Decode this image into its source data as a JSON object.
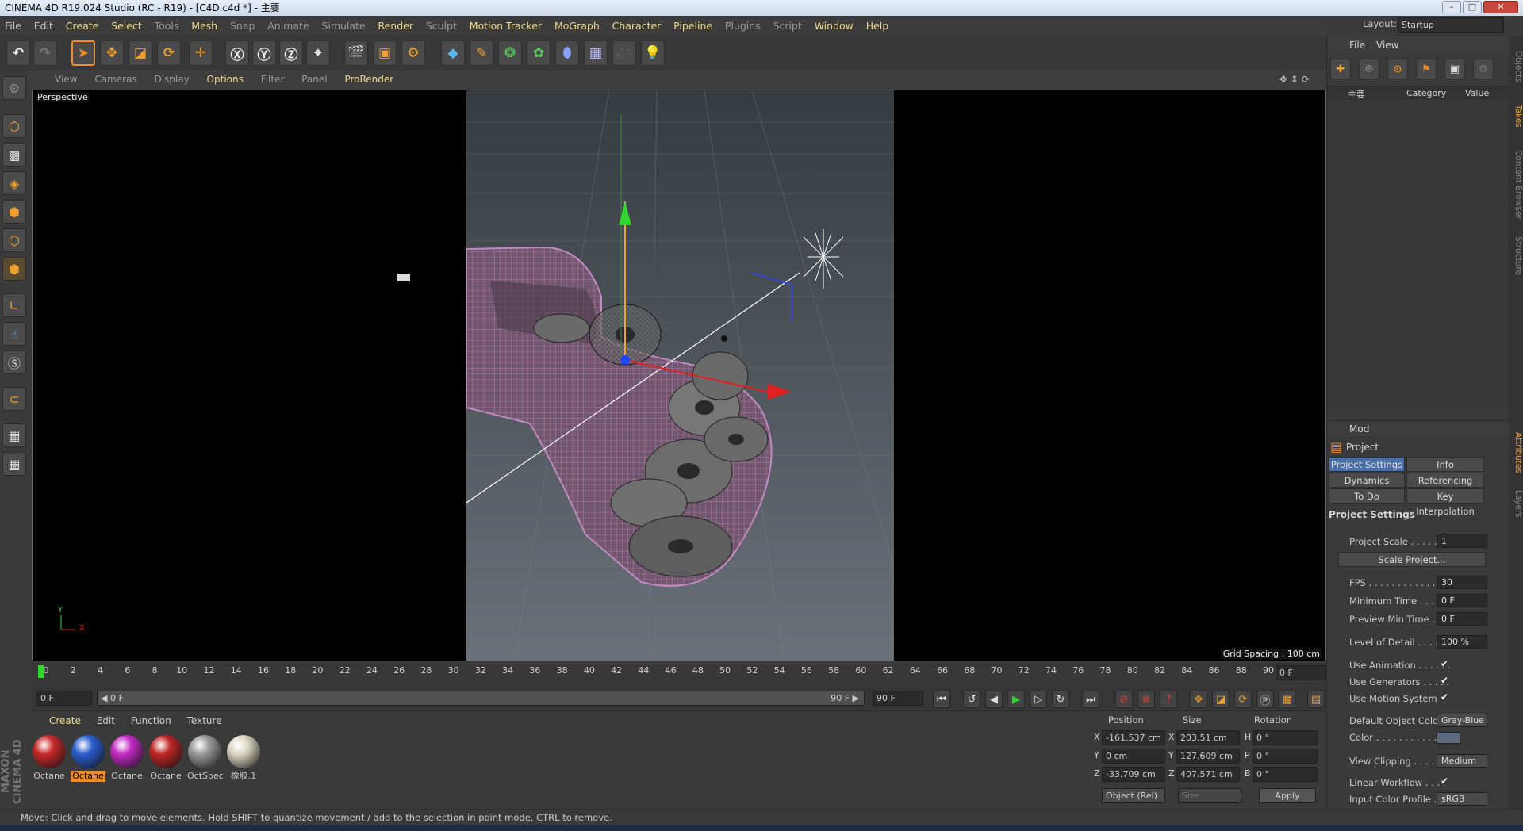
{
  "window": {
    "title": "CINEMA 4D R19.024 Studio (RC - R19) - [C4D.c4d *] - 主要",
    "layout_label": "Layout:",
    "layout_value": "Startup"
  },
  "menu": {
    "items": [
      "File",
      "Edit",
      "Create",
      "Select",
      "Tools",
      "Mesh",
      "Snap",
      "Animate",
      "Simulate",
      "Render",
      "Sculpt",
      "Motion Tracker",
      "MoGraph",
      "Character",
      "Pipeline",
      "Plugins",
      "Script",
      "Window",
      "Help"
    ]
  },
  "viewport": {
    "menu": [
      "View",
      "Cameras",
      "Display",
      "Options",
      "Filter",
      "Panel",
      "ProRender"
    ],
    "label": "Perspective",
    "grid_spacing": "Grid Spacing : 100 cm",
    "axis_y": "Y",
    "axis_x": "X"
  },
  "timeline": {
    "ticks": [
      "0",
      "2",
      "4",
      "6",
      "8",
      "10",
      "12",
      "14",
      "16",
      "18",
      "20",
      "22",
      "24",
      "26",
      "28",
      "30",
      "32",
      "34",
      "36",
      "38",
      "40",
      "42",
      "44",
      "46",
      "48",
      "50",
      "52",
      "54",
      "56",
      "58",
      "60",
      "62",
      "64",
      "66",
      "68",
      "70",
      "72",
      "74",
      "76",
      "78",
      "80",
      "82",
      "84",
      "86",
      "88",
      "90"
    ],
    "current_frame": "0 F",
    "start_field": "0 F",
    "range_start": "◀ 0 F",
    "range_end": "90 F ▶",
    "end_field": "90 F"
  },
  "materials": {
    "menu": [
      "Create",
      "Edit",
      "Function",
      "Texture"
    ],
    "items": [
      {
        "label": "Octane",
        "color": "#c8282a"
      },
      {
        "label": "Octane",
        "color": "#2a5ed0"
      },
      {
        "label": "Octane",
        "color": "#c42ac4"
      },
      {
        "label": "Octane",
        "color": "#c02626"
      },
      {
        "label": "OctSpec",
        "color": "#9a9a9a"
      },
      {
        "label": "橡胶.1",
        "color": "#dcd6c2"
      }
    ]
  },
  "coords": {
    "headers": [
      "Position",
      "Size",
      "Rotation"
    ],
    "rows": [
      {
        "axis": "X",
        "pos": "-161.537 cm",
        "size_axis": "X",
        "size": "203.51 cm",
        "rot_axis": "H",
        "rot": "0 °"
      },
      {
        "axis": "Y",
        "pos": "0 cm",
        "size_axis": "Y",
        "size": "127.609 cm",
        "rot_axis": "P",
        "rot": "0 °"
      },
      {
        "axis": "Z",
        "pos": "-33.709 cm",
        "size_axis": "Z",
        "size": "407.571 cm",
        "rot_axis": "B",
        "rot": "0 °"
      }
    ],
    "mode": "Object (Rel)",
    "size_mode": "Size",
    "apply": "Apply"
  },
  "status": "Move: Click and drag to move elements. Hold SHIFT to quantize movement / add to the selection in point mode, CTRL to remove.",
  "objects": {
    "menu": [
      "File",
      "View"
    ],
    "tree_item": "主要",
    "col_category": "Category",
    "col_value": "Value"
  },
  "attributes": {
    "mode_label": "Mod",
    "title": "Project",
    "tabs": [
      "Project Settings",
      "Info",
      "Dynamics",
      "Referencing",
      "To Do",
      "Key Interpolation"
    ],
    "section": "Project Settings",
    "scale_button": "Scale Project...",
    "props": [
      {
        "label": "Project Scale . . . . . . .",
        "value": "1"
      },
      {
        "label": "FPS . . . . . . . . . . . . . .",
        "value": "30"
      },
      {
        "label": "Minimum Time . . . . .",
        "value": "0 F"
      },
      {
        "label": "Preview Min Time . . .",
        "value": "0 F"
      },
      {
        "label": "Level of Detail . . . . . .",
        "value": "100 %"
      }
    ],
    "checks": [
      "Use Animation . . . . . .",
      "Use Generators . . . . .",
      "Use Motion System"
    ],
    "default_color_label": "Default Object Color",
    "default_color_value": "Gray-Blue",
    "color_label": "Color . . . . . . . . . . .",
    "view_clipping_label": "View Clipping . . . . . .",
    "view_clipping_value": "Medium",
    "linear_label": "Linear Workflow . . . .",
    "icp_label": "Input Color Profile . .",
    "icp_value": "sRGB"
  },
  "side_tabs": [
    "Objects",
    "Takes",
    "Content Browser",
    "Structure",
    "Attributes",
    "Layers"
  ],
  "brand": "MAXON CINEMA 4D"
}
